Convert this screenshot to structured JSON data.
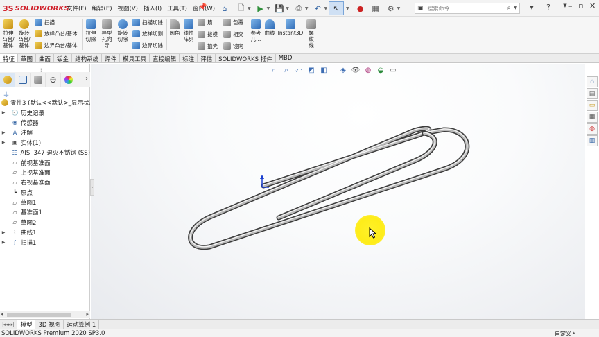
{
  "app": {
    "brand_ds": "3S",
    "brand_name": "SOLIDWORKS"
  },
  "menu": [
    "文件(F)",
    "编辑(E)",
    "视图(V)",
    "插入(I)",
    "工具(T)",
    "窗口(W)"
  ],
  "search": {
    "placeholder": "搜索命令"
  },
  "commands": {
    "extrude_boss": "拉伸凸台/基体",
    "revolve_boss": "旋转凸台/基体",
    "sweep": "扫描",
    "loft": "放样凸台/基体",
    "boundary_boss": "边界凸台/基体",
    "extrude_cut": "拉伸切除",
    "hole_wizard": "异型孔向导",
    "revolve_cut": "旋转切除",
    "swept_cut": "扫描切除",
    "lofted_cut": "放样切割",
    "boundary_cut": "边界切除",
    "fillet": "圆角",
    "linear_pattern": "线性阵列",
    "rib": "筋",
    "draft": "拔模",
    "shell": "抽壳",
    "wrap": "包覆",
    "intersect": "相交",
    "mirror": "镜向",
    "reference_geometry": "参考几...",
    "curves": "曲线",
    "instant3d": "Instant3D",
    "helix": "螺纹线"
  },
  "tabs": [
    "特征",
    "草图",
    "曲面",
    "钣金",
    "结构系统",
    "焊件",
    "模具工具",
    "直接编辑",
    "标注",
    "评估",
    "SOLIDWORKS 插件",
    "MBD"
  ],
  "active_tab": "特征",
  "tree": {
    "root": "零件3 (默认<<默认>_显示状态",
    "items": [
      {
        "label": "历史记录",
        "icon": "history-icon",
        "expand": true
      },
      {
        "label": "传感器",
        "icon": "sensor-icon",
        "expand": false
      },
      {
        "label": "注解",
        "icon": "annotations-icon",
        "expand": true
      },
      {
        "label": "实体(1)",
        "icon": "solid-bodies-icon",
        "expand": true
      },
      {
        "label": "AISI 347 退火不锈钢 (SS)",
        "icon": "material-icon",
        "expand": false
      },
      {
        "label": "前视基准面",
        "icon": "plane-icon",
        "expand": false
      },
      {
        "label": "上视基准面",
        "icon": "plane-icon",
        "expand": false
      },
      {
        "label": "右视基准面",
        "icon": "plane-icon",
        "expand": false
      },
      {
        "label": "原点",
        "icon": "origin-icon",
        "expand": false
      },
      {
        "label": "草图1",
        "icon": "sketch-icon",
        "expand": false
      },
      {
        "label": "基准面1",
        "icon": "plane-icon",
        "expand": false
      },
      {
        "label": "草图2",
        "icon": "sketch-icon",
        "expand": false
      },
      {
        "label": "曲线1",
        "icon": "curve-icon",
        "expand": true
      },
      {
        "label": "扫描1",
        "icon": "sweep-icon",
        "expand": true
      }
    ]
  },
  "bottom_tabs": [
    "模型",
    "3D 视图",
    "运动算例 1"
  ],
  "active_bottom_tab": "模型",
  "status": {
    "product": "SOLIDWORKS Premium 2020 SP3.0",
    "units": "自定义"
  },
  "colors": {
    "brand_red": "#d0202a",
    "selection_blue": "#cfe0f4",
    "cursor_highlight": "#fff200"
  }
}
